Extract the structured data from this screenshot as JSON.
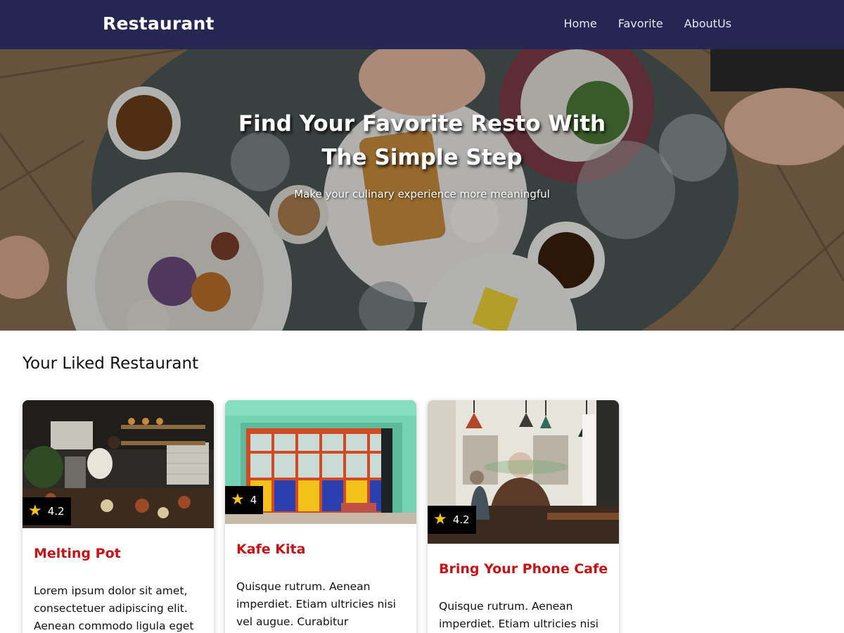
{
  "header": {
    "brand": "Restaurant",
    "nav": [
      {
        "label": "Home"
      },
      {
        "label": "Favorite"
      },
      {
        "label": "AboutUs"
      }
    ]
  },
  "hero": {
    "title_line1": "Find Your Favorite Resto With",
    "title_line2": "The Simple Step",
    "subtitle": "Make your culinary experience more meaningful"
  },
  "liked": {
    "title": "Your Liked Restaurant",
    "cards": [
      {
        "name": "Melting Pot",
        "rating": "4.2",
        "description": "Lorem ipsum dolor sit amet, consectetuer adipiscing elit. Aenean commodo ligula eget"
      },
      {
        "name": "Kafe Kita",
        "rating": "4",
        "description": "Quisque rutrum. Aenean imperdiet. Etiam ultricies nisi vel augue. Curabitur"
      },
      {
        "name": "Bring Your Phone Cafe",
        "rating": "4.2",
        "description": "Quisque rutrum. Aenean imperdiet. Etiam ultricies nisi"
      }
    ]
  },
  "colors": {
    "navbar": "#252651",
    "restaurant_name": "#c41416",
    "star": "#f7c21a"
  }
}
